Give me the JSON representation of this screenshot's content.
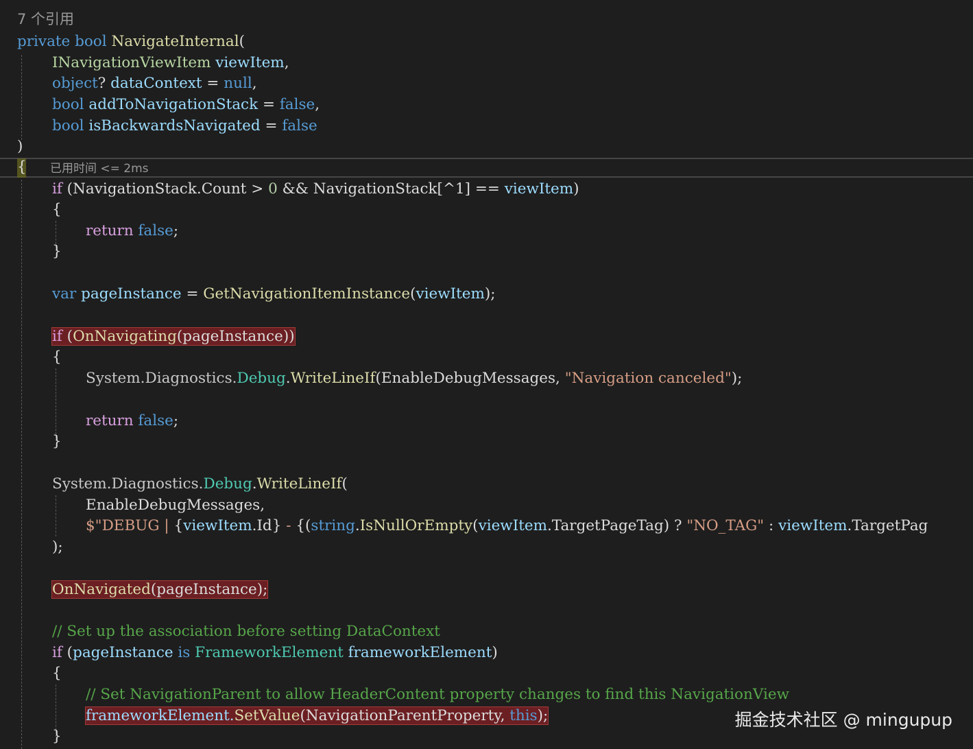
{
  "codelens": {
    "references": "7 个引用",
    "elapsed": "已用时间 <= 2ms"
  },
  "code": {
    "l1_private": "private",
    "l1_bool": "bool",
    "l1_name": "NavigateInternal",
    "l1_open": "(",
    "l2_type": "INavigationViewItem",
    "l2_param": "viewItem",
    "l2_comma": ",",
    "l3_type": "object",
    "l3_q": "?",
    "l3_param": "dataContext",
    "l3_eq": " = ",
    "l3_val": "null",
    "l3_comma": ",",
    "l4_type": "bool",
    "l4_param": "addToNavigationStack",
    "l4_eq": " = ",
    "l4_val": "false",
    "l4_comma": ",",
    "l5_type": "bool",
    "l5_param": "isBackwardsNavigated",
    "l5_eq": " = ",
    "l5_val": "false",
    "l6_close": ")",
    "l7_brace": "{",
    "l8_if": "if",
    "l8_rest1": " (NavigationStack.",
    "l8_count": "Count",
    "l8_rest2": " > ",
    "l8_zero": "0",
    "l8_rest3": " && NavigationStack[^1] == ",
    "l8_param": "viewItem",
    "l8_rest4": ")",
    "l9_brace": "{",
    "l10_return": "return",
    "l10_false": "false",
    "l10_semi": ";",
    "l11_brace": "}",
    "l13_var": "var",
    "l13_name": "pageInstance",
    "l13_eq": " = ",
    "l13_method": "GetNavigationItemInstance",
    "l13_open": "(",
    "l13_param": "viewItem",
    "l13_close": ");",
    "l15_if": "if",
    "l15_rest1": " (",
    "l15_method": "OnNavigating",
    "l15_rest2": "(pageInstance))",
    "l16_brace": "{",
    "l17_sys": "System.Diagnostics.",
    "l17_debug": "Debug",
    "l17_dot": ".",
    "l17_method": "WriteLineIf",
    "l17_args": "(EnableDebugMessages, ",
    "l17_str": "\"Navigation canceled\"",
    "l17_end": ");",
    "l19_return": "return",
    "l19_false": "false",
    "l19_semi": ";",
    "l20_brace": "}",
    "l22_sys": "System.Diagnostics.",
    "l22_debug": "Debug",
    "l22_dot": ".",
    "l22_method": "WriteLineIf",
    "l22_open": "(",
    "l23_arg": "EnableDebugMessages,",
    "l24_str1": "$\"DEBUG | ",
    "l24_interp1": "{",
    "l24_param1": "viewItem",
    "l24_id": ".Id",
    "l24_interp2": "}",
    "l24_str2": " - ",
    "l24_interp3": "{(",
    "l24_string": "string",
    "l24_dot": ".",
    "l24_method": "IsNullOrEmpty",
    "l24_open": "(",
    "l24_param2": "viewItem",
    "l24_tag": ".TargetPageTag) ? ",
    "l24_notag": "\"NO_TAG\"",
    "l24_colon": " : ",
    "l24_param3": "viewItem",
    "l24_tail": ".TargetPag",
    "l25_close": ");",
    "l27_method": "OnNavigated",
    "l27_args": "(pageInstance);",
    "l29_comment": "// Set up the association before setting DataContext",
    "l30_if": "if",
    "l30_rest1": " (",
    "l30_name": "pageInstance",
    "l30_is": " is ",
    "l30_type": "FrameworkElement",
    "l30_var": " frameworkElement",
    "l30_close": ")",
    "l31_brace": "{",
    "l32_comment": "// Set NavigationParent to allow HeaderContent property changes to find this NavigationView",
    "l33_obj": "frameworkElement.",
    "l33_method": "SetValue",
    "l33_args": "(NavigationParentProperty, ",
    "l33_this": "this",
    "l33_end": ");",
    "l34_brace": "}"
  },
  "watermark": "掘金技术社区 @ mingupup",
  "colors": {
    "background": "#1e1e1e",
    "keyword": "#569cd6",
    "control": "#d8a0df",
    "type": "#b8d7a3",
    "class": "#4ec9b0",
    "method": "#dcdcaa",
    "parameter": "#9cdcfe",
    "string": "#d69d85",
    "comment": "#57a64a",
    "breakpoint_highlight": "#6b1f22"
  }
}
